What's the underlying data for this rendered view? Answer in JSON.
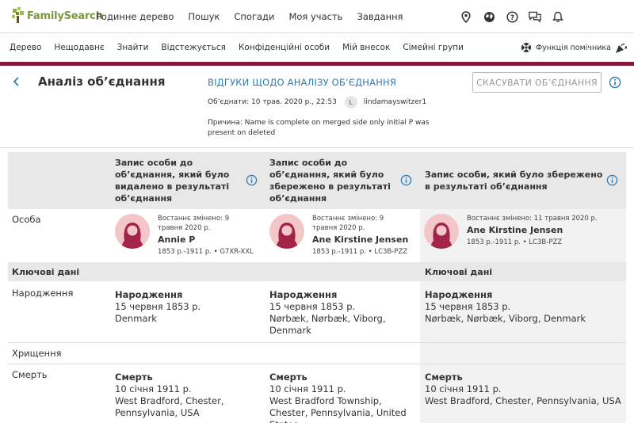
{
  "logo": {
    "text": "FamilySearch"
  },
  "topnav": {
    "items": [
      "Родинне дерево",
      "Пошук",
      "Спогади",
      "Моя участь",
      "Завдання"
    ]
  },
  "subnav": {
    "items": [
      "Дерево",
      "Нещодавнє",
      "Знайти",
      "Відстежується",
      "Конфіденційні особи",
      "Мій внесок",
      "Сімейні групи"
    ],
    "helper": "Функція помічника"
  },
  "header": {
    "title": "Аналіз об’єднання",
    "feedback": "ВІДГУКИ ЩОДО АНАЛІЗУ ОБ’ЄДНАННЯ",
    "merged": "Об’єднати: 10 трав. 2020 р., 22:53",
    "user_initial": "L",
    "user": "lindamayswitzer1",
    "reason": "Причина: Name is complete on merged side only initial P was present on deleted",
    "undo": "СКАСУВАТИ ОБ’ЄДНАННЯ"
  },
  "columns": {
    "deleted": "Запис особи до об’єднання, який було видалено в результаті об’єднання",
    "kept": "Запис особи до об’єднання, який було збережено в результаті об’єднання",
    "result": "Запис особи, який було збережено в результаті об’єднання"
  },
  "rows": {
    "person": "Особа",
    "birth": "Народження",
    "christening": "Хрищення",
    "death": "Смерть"
  },
  "section": {
    "key_data": "Ключові дані"
  },
  "persons": {
    "deleted": {
      "modified": "Востаннє змінено: 9 травня 2020 р.",
      "name": "Annie P",
      "dates": "1853 р.-1911 р. • G7XR-XXL"
    },
    "kept": {
      "modified": "Востаннє змінено: 9 травня 2020 р.",
      "name": "Ane Kirstine Jensen",
      "dates": "1853 р.-1911 р. • LC3B-PZZ"
    },
    "result": {
      "modified": "Востаннє змінено: 11 травня 2020 р.",
      "name": "Ane Kirstine Jensen",
      "dates": "1853 р.-1911 р. • LC3B-PZZ"
    }
  },
  "facts": {
    "birth_label": "Народження",
    "death_label": "Смерть",
    "deleted": {
      "birth_date": "15 червня 1853 р.",
      "birth_place": "Denmark",
      "death_date": "10 січня 1911 р.",
      "death_place": "West Bradford, Chester, Pennsylvania, USA"
    },
    "kept": {
      "birth_date": "15 червня 1853 р.",
      "birth_place": "Nørbæk, Nørbæk, Viborg, Denmark",
      "death_date": "10 січня 1911 р.",
      "death_place": "West Bradford Township, Chester, Pennsylvania, United States"
    },
    "result": {
      "birth_date": "15 червня 1853 р.",
      "birth_place": "Nørbæk, Nørbæk, Viborg, Denmark",
      "death_date": "10 січня 1911 р.",
      "death_place": "West Bradford, Chester, Pennsylvania, USA"
    }
  },
  "colors": {
    "accent_bar": "#85173a",
    "link": "#2d7db3",
    "logo": "#7a9a3b",
    "portrait_bg": "#f3c6c7",
    "portrait_fg": "#a3234a"
  }
}
